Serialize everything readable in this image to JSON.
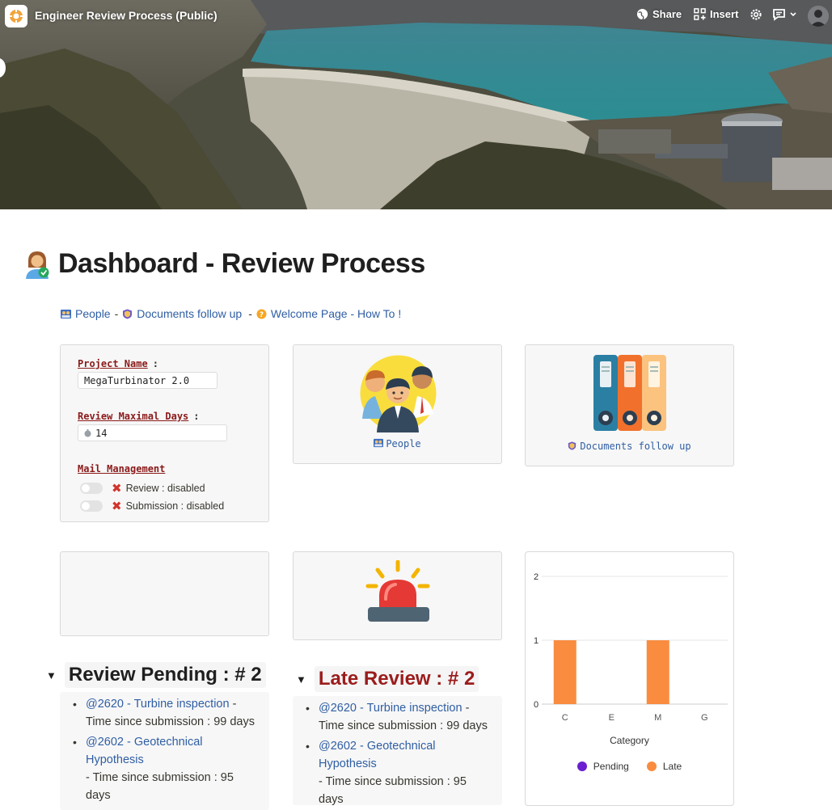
{
  "app": {
    "title": "Engineer Review Process (Public)"
  },
  "toolbar": {
    "share_label": "Share",
    "insert_label": "Insert"
  },
  "page": {
    "title": "Dashboard - Review Process"
  },
  "links": [
    {
      "label": "People"
    },
    {
      "label": "Documents follow up"
    },
    {
      "label": "Welcome Page - How To !"
    }
  ],
  "links_separator": "-",
  "project": {
    "name_label": "Project Name",
    "name_value": "MegaTurbinator 2.0",
    "days_label": "Review Maximal Days",
    "days_value": "14",
    "mail_label": "Mail Management",
    "colon": ":",
    "toggles": [
      {
        "label": "Review : disabled",
        "on": false
      },
      {
        "label": "Submission : disabled",
        "on": false
      }
    ]
  },
  "cards": {
    "people_label": "People",
    "documents_label": "Documents follow up"
  },
  "pending": {
    "title": "Review Pending : # 2",
    "items": [
      {
        "link": "@2620 - Turbine inspection",
        "suffix": " -",
        "detail": "Time since submission : 99 days"
      },
      {
        "link": "@2602 - Geotechnical Hypothesis",
        "suffix": "",
        "detail": "- Time since submission : 95 days"
      }
    ]
  },
  "late": {
    "title": "Late Review : # 2",
    "items": [
      {
        "link": "@2620 - Turbine inspection",
        "suffix": " -",
        "detail": "Time since submission : 99 days"
      },
      {
        "link": "@2602 - Geotechnical Hypothesis",
        "suffix": "",
        "detail": "- Time since submission : 95 days"
      }
    ]
  },
  "colors": {
    "accent_link": "#2f5ea3",
    "late_title": "#9b1c1c",
    "pending_series": "#6a1fd0",
    "late_series": "#f98c3f",
    "label_red": "#8b1a1a"
  },
  "chart_data": {
    "type": "bar",
    "categories": [
      "C",
      "E",
      "M",
      "G"
    ],
    "series": [
      {
        "name": "Pending",
        "values": [
          0,
          0,
          0,
          0
        ]
      },
      {
        "name": "Late",
        "values": [
          1,
          0,
          1,
          0
        ]
      }
    ],
    "xlabel": "Category",
    "ylabel": "",
    "ylim": [
      0,
      2
    ],
    "yticks": [
      "0",
      "1",
      "2"
    ],
    "grid": true,
    "legend": "bottom"
  }
}
